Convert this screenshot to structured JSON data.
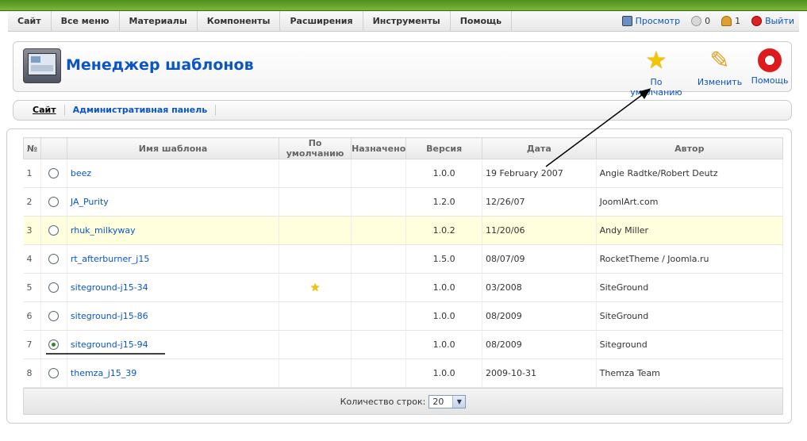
{
  "menubar": {
    "items": [
      "Сайт",
      "Все меню",
      "Материалы",
      "Компоненты",
      "Расширения",
      "Инструменты",
      "Помощь"
    ],
    "preview": "Просмотр",
    "messages_count": "0",
    "users_count": "1",
    "logout": "Выйти"
  },
  "header": {
    "title": "Менеджер шаблонов",
    "buttons": {
      "default": "По умолчанию",
      "edit": "Изменить",
      "help": "Помощь"
    }
  },
  "subnav": {
    "items": [
      "Сайт",
      "Административная панель"
    ]
  },
  "table": {
    "headers": [
      "№",
      "Имя шаблона",
      "По умолчанию",
      "Назначено",
      "Версия",
      "Дата",
      "Автор"
    ],
    "rows": [
      {
        "num": "1",
        "name": "beez",
        "version": "1.0.0",
        "date": "19 February 2007",
        "author": "Angie Radtke/Robert Deutz",
        "default": false,
        "selected": false
      },
      {
        "num": "2",
        "name": "JA_Purity",
        "version": "1.2.0",
        "date": "12/26/07",
        "author": "JoomlArt.com",
        "default": false,
        "selected": false
      },
      {
        "num": "3",
        "name": "rhuk_milkyway",
        "version": "1.0.2",
        "date": "11/20/06",
        "author": "Andy Miller",
        "default": false,
        "selected": false,
        "highlighted": true
      },
      {
        "num": "4",
        "name": "rt_afterburner_j15",
        "version": "1.5.0",
        "date": "08/07/09",
        "author": "RocketTheme / Joomla.ru",
        "default": false,
        "selected": false
      },
      {
        "num": "5",
        "name": "siteground-j15-34",
        "version": "1.0.0",
        "date": "03/2008",
        "author": "SiteGround",
        "default": true,
        "selected": false
      },
      {
        "num": "6",
        "name": "siteground-j15-86",
        "version": "1.0.0",
        "date": "08/2009",
        "author": "SiteGround",
        "default": false,
        "selected": false
      },
      {
        "num": "7",
        "name": "siteground-j15-94",
        "version": "1.0.0",
        "date": "08/2009",
        "author": "Siteground",
        "default": false,
        "selected": true
      },
      {
        "num": "8",
        "name": "themza_j15_39",
        "version": "1.0.0",
        "date": "2009-10-31",
        "author": "Themza Team",
        "default": false,
        "selected": false
      }
    ]
  },
  "footer": {
    "rows_label": "Количество строк:",
    "rows_value": "20"
  },
  "icons": {
    "default": "star-icon",
    "edit": "pencil-icon",
    "help": "lifebuoy-icon"
  },
  "colors": {
    "link": "#0b55c4",
    "highlight_row": "#ffffdd",
    "top_bar": "#5e9e25"
  }
}
